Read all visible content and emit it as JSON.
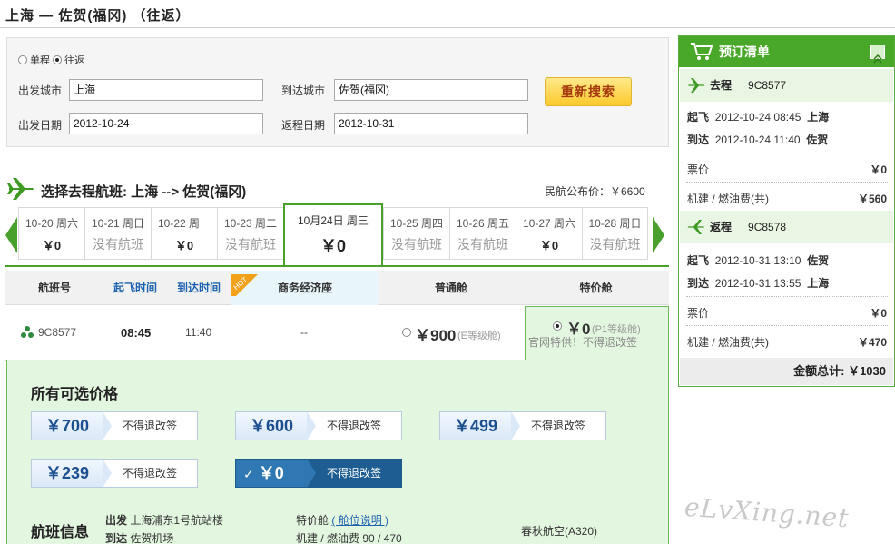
{
  "header": {
    "route_title": "上海 — 佐贺(福冈) （往返）"
  },
  "search": {
    "trip_oneway": "单程",
    "trip_round": "往返",
    "from_label": "出发城市",
    "from_value": "上海",
    "to_label": "到达城市",
    "to_value": "佐贺(福冈)",
    "depart_label": "出发日期",
    "depart_value": "2012-10-24",
    "return_label": "返程日期",
    "return_value": "2012-10-31",
    "button": "重新搜索"
  },
  "section": {
    "title": "选择去程航班: 上海 --> 佐贺(福冈)",
    "public_price": "民航公布价：￥6600"
  },
  "dates": [
    {
      "date": "10-20 周六",
      "price": "￥0"
    },
    {
      "date": "10-21 周日",
      "price": "没有航班"
    },
    {
      "date": "10-22 周一",
      "price": "￥0"
    },
    {
      "date": "10-23 周二",
      "price": "没有航班"
    },
    {
      "date": "10月24日 周三",
      "price": "￥0"
    },
    {
      "date": "10-25 周四",
      "price": "没有航班"
    },
    {
      "date": "10-26 周五",
      "price": "没有航班"
    },
    {
      "date": "10-27 周六",
      "price": "￥0"
    },
    {
      "date": "10-28 周日",
      "price": "没有航班"
    }
  ],
  "columns": {
    "flight_no": "航班号",
    "depart_time": "起飞时间",
    "arrive_time": "到达时间",
    "hot": "HOT",
    "business": "商务经济座",
    "economy": "普通舱",
    "special": "特价舱"
  },
  "flight": {
    "no": "9C8577",
    "depart": "08:45",
    "arrive": "11:40",
    "business": "--",
    "economy_price": "￥900",
    "economy_class": "(E等级舱)",
    "special_price": "￥0",
    "special_class": "(P1等级舱)",
    "special_note": "官网特供！不得退改签"
  },
  "price_panel": {
    "title": "所有可选价格",
    "options": [
      {
        "price": "￥700",
        "rule": "不得退改签"
      },
      {
        "price": "￥600",
        "rule": "不得退改签"
      },
      {
        "price": "￥499",
        "rule": "不得退改签"
      },
      {
        "price": "￥239",
        "rule": "不得退改签"
      },
      {
        "price": "￥0",
        "rule": "不得退改签"
      }
    ]
  },
  "flight_info": {
    "title": "航班信息",
    "depart_label": "出发",
    "depart_place": "上海浦东1号航站楼",
    "arrive_label": "到达",
    "arrive_place": "佐贺机场",
    "cabin": "特价舱",
    "cabin_link": "( 舱位说明 )",
    "tax": "机建 / 燃油费 90 / 470",
    "airline": "春秋航空(A320)"
  },
  "watermark": "eLvXing.net",
  "order": {
    "title": "预订清单",
    "out": {
      "label": "去程",
      "flight": "9C8577",
      "dep_label": "起飞",
      "dep_time": "2012-10-24 08:45",
      "dep_city": "上海",
      "arr_label": "到达",
      "arr_time": "2012-10-24 11:40",
      "arr_city": "佐贺",
      "fare_label": "票价",
      "fare": "￥0",
      "tax_label": "机建 / 燃油费(共)",
      "tax": "￥560"
    },
    "ret": {
      "label": "返程",
      "flight": "9C8578",
      "dep_label": "起飞",
      "dep_time": "2012-10-31 13:10",
      "dep_city": "佐贺",
      "arr_label": "到达",
      "arr_time": "2012-10-31 13:55",
      "arr_city": "上海",
      "fare_label": "票价",
      "fare": "￥0",
      "tax_label": "机建 / 燃油费(共)",
      "tax": "￥470"
    },
    "total": "金额总计: ￥1030"
  },
  "colors": {
    "accent_green": "#49a72a",
    "panel_green": "#e3f7e0",
    "blue": "#1c62b0",
    "button_text": "#a4380c"
  }
}
